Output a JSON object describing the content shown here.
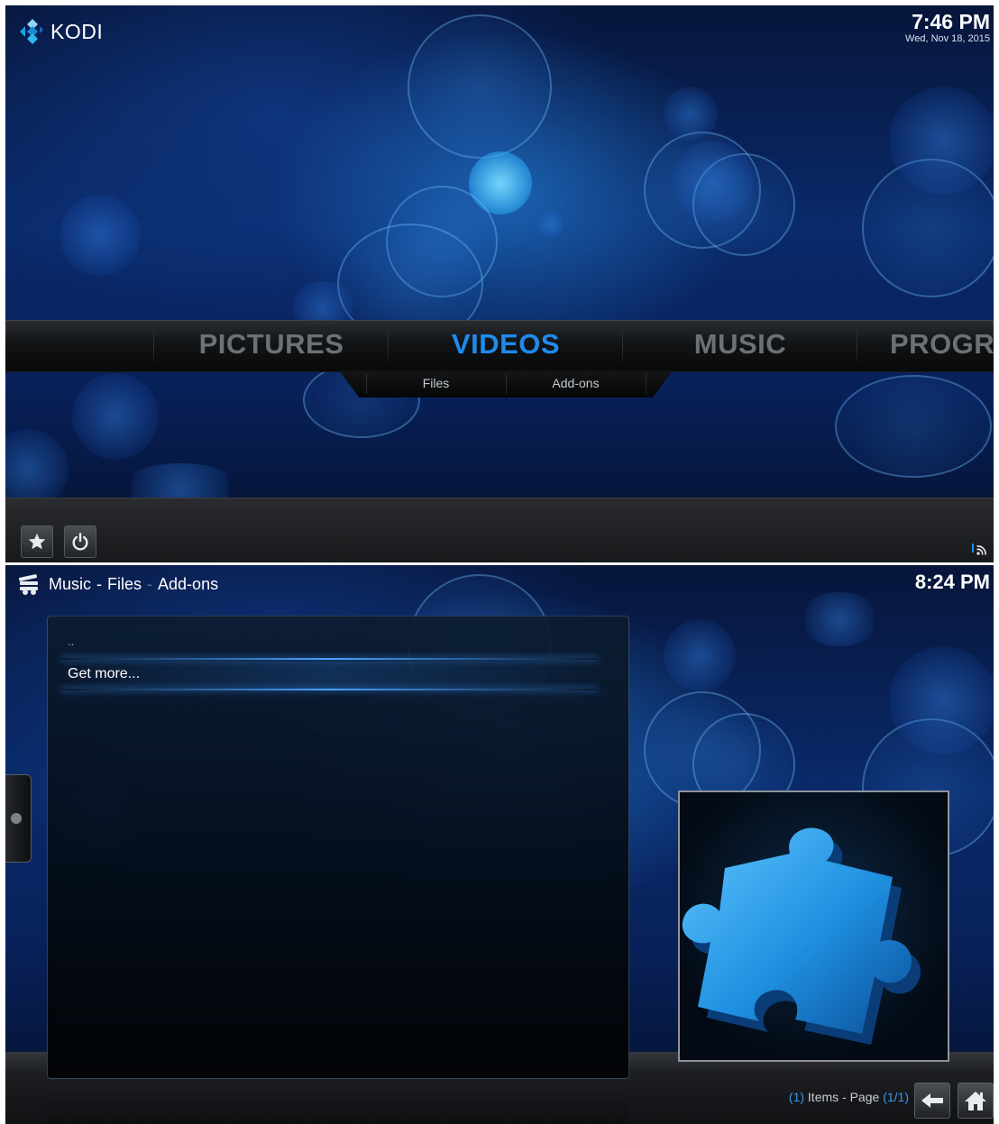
{
  "home": {
    "brand": "KODI",
    "clock": {
      "time": "7:46 PM",
      "date": "Wed, Nov 18, 2015"
    },
    "menu": [
      {
        "label": "PICTURES",
        "active": false
      },
      {
        "label": "VIDEOS",
        "active": true
      },
      {
        "label": "MUSIC",
        "active": false
      },
      {
        "label": "PROGR",
        "active": false
      }
    ],
    "submenu": [
      "Files",
      "Add-ons"
    ],
    "footer_icons": [
      "star-icon",
      "power-icon"
    ],
    "status_icon": "rss-icon"
  },
  "addons": {
    "breadcrumb": {
      "part1": "Music",
      "sep1": "-",
      "part2": "Files",
      "sep2": "-",
      "part3": "Add-ons"
    },
    "header_icon": "music-icon",
    "clock": "8:24 PM",
    "list": [
      "..",
      "Get more..."
    ],
    "thumbnail_icon": "puzzle-piece-icon",
    "status": {
      "count": "1",
      "items_label": "Items - Page",
      "page": "1/1"
    },
    "nav_icons": [
      "back-arrow-icon",
      "home-icon"
    ]
  },
  "colors": {
    "accent": "#1f8bee",
    "inactive_menu": "#6e7174",
    "background": "#0a2a6a"
  }
}
